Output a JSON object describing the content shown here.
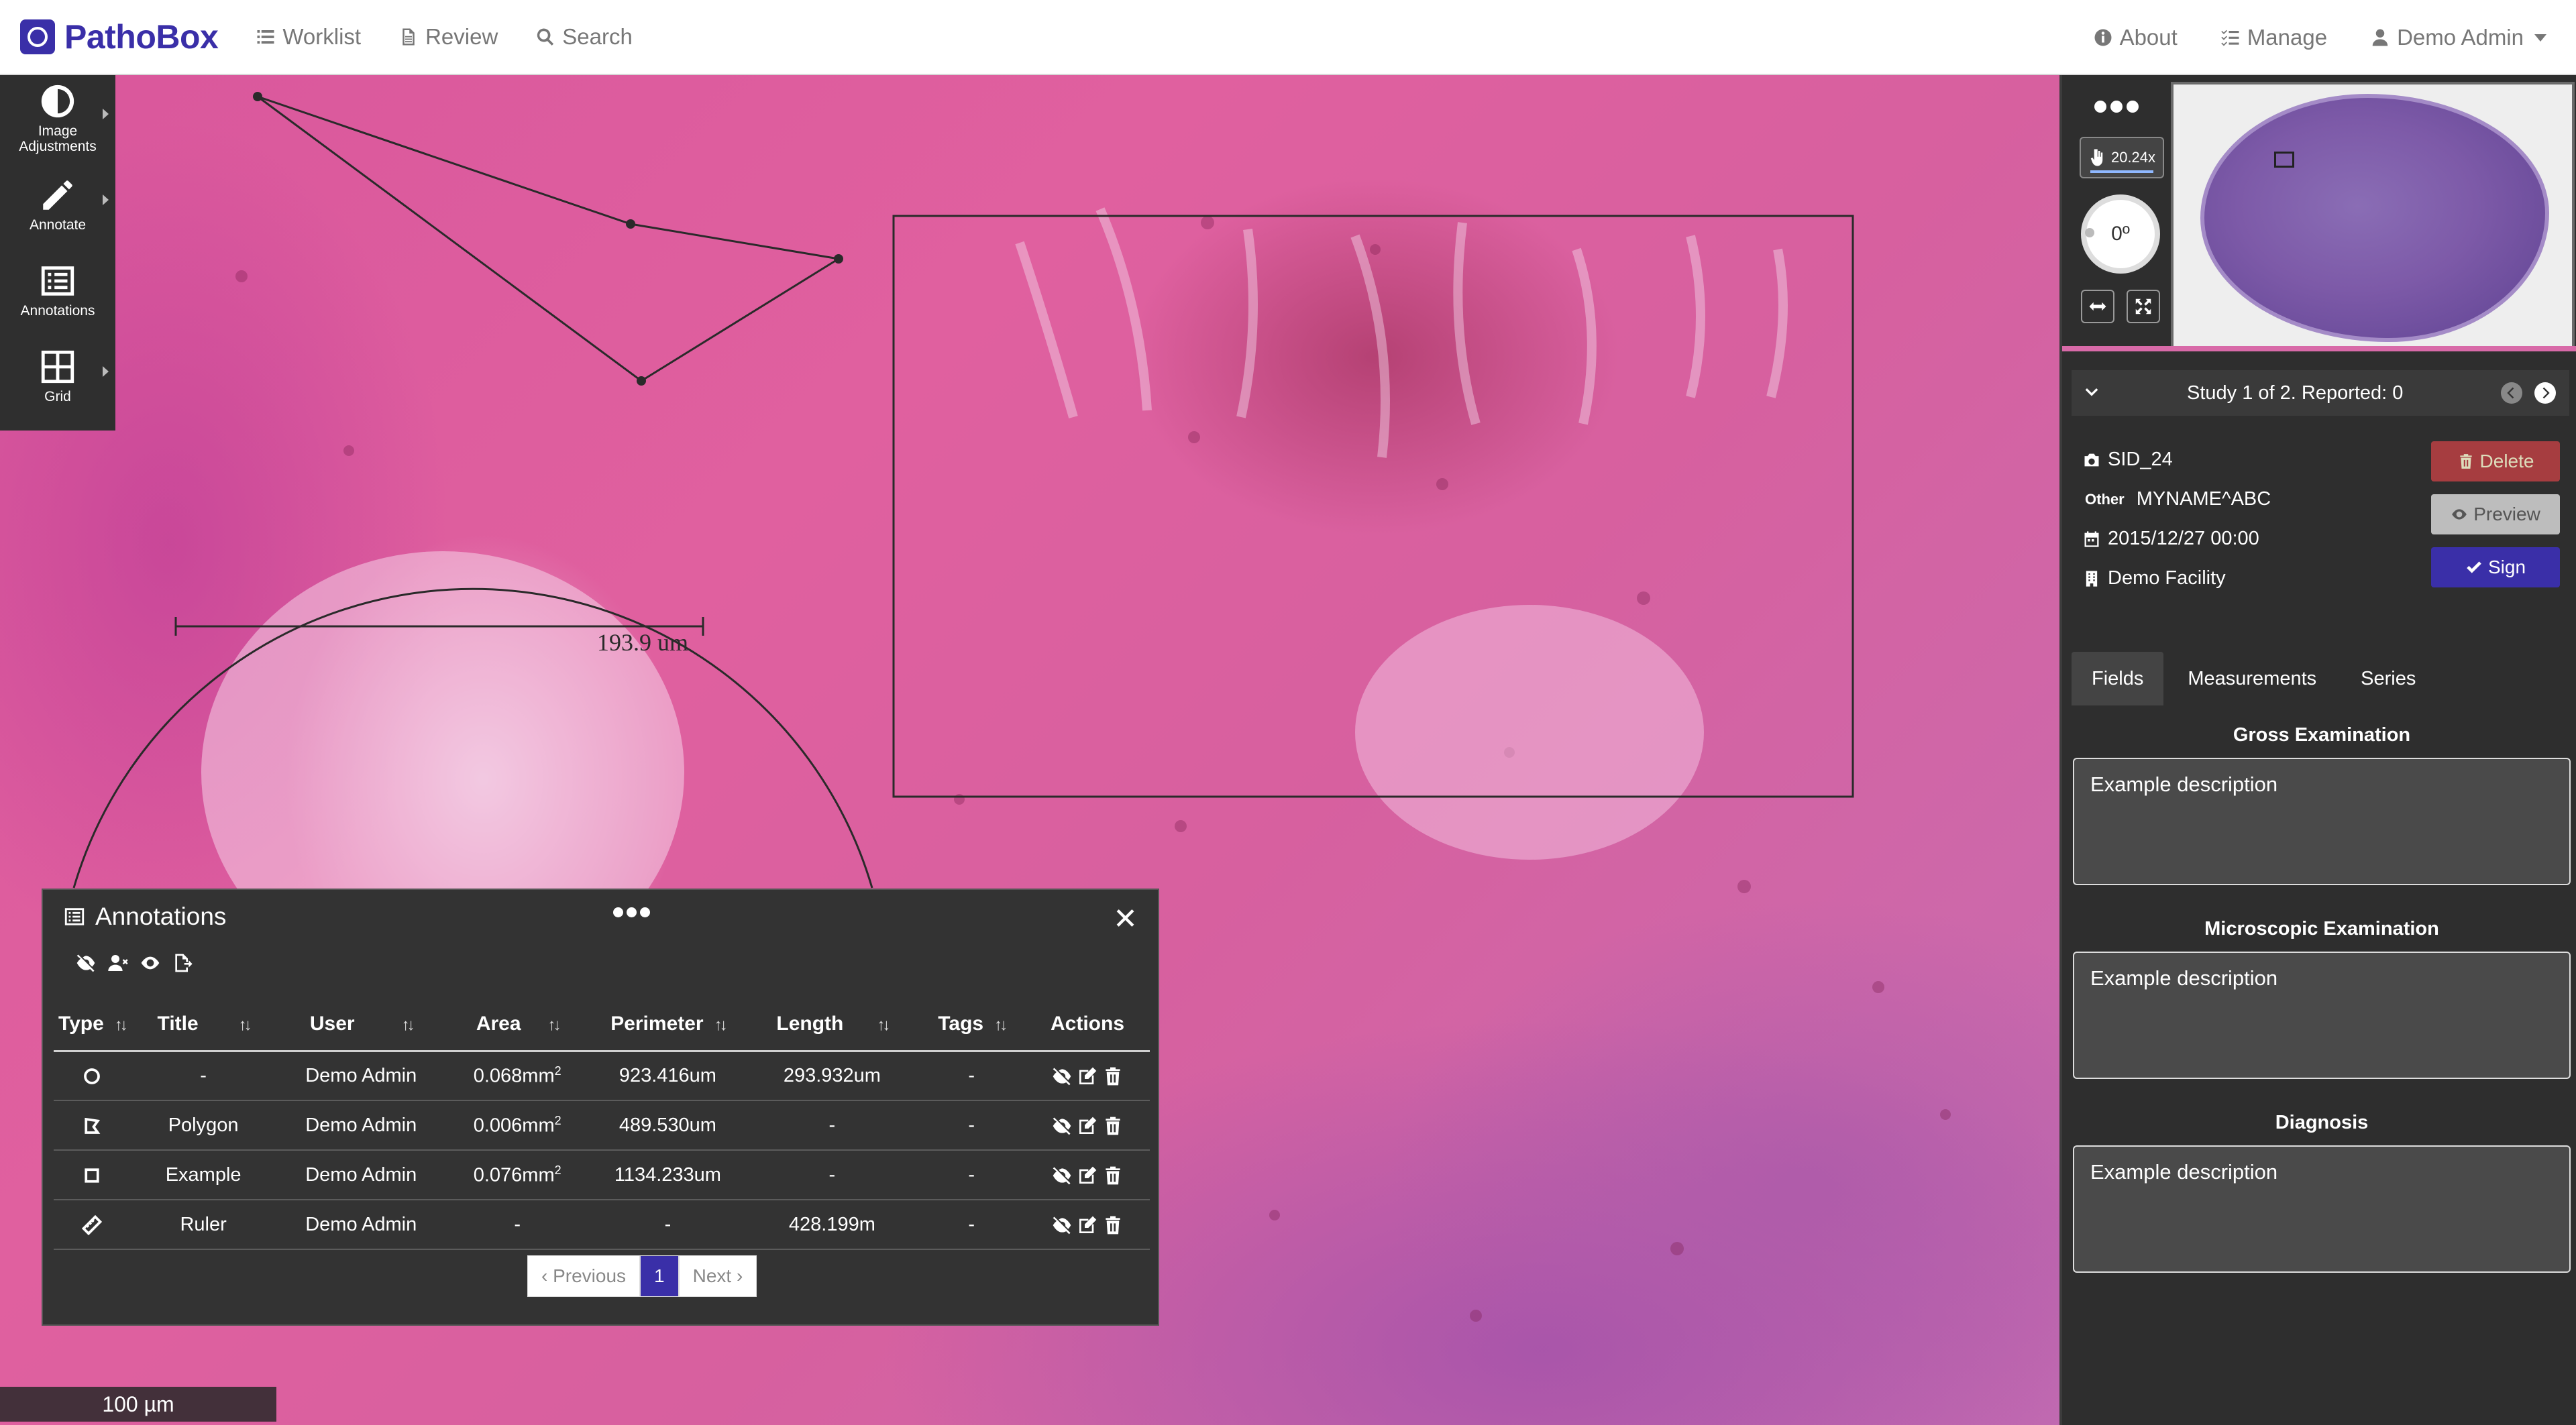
{
  "navbar": {
    "brand": "PathoBox",
    "links": [
      {
        "label": "Worklist",
        "icon": "list-icon"
      },
      {
        "label": "Review",
        "icon": "file-icon"
      },
      {
        "label": "Search",
        "icon": "search-icon"
      }
    ],
    "right": [
      {
        "label": "About",
        "icon": "info-icon"
      },
      {
        "label": "Manage",
        "icon": "tasks-icon"
      },
      {
        "label": "Demo Admin",
        "icon": "user-icon"
      }
    ]
  },
  "tools": [
    {
      "label": "Image Adjustments",
      "icon": "contrast-icon"
    },
    {
      "label": "Annotate",
      "icon": "pencil-icon"
    },
    {
      "label": "Annotations",
      "icon": "list-alt-icon"
    },
    {
      "label": "Grid",
      "icon": "grid-icon"
    }
  ],
  "viewer": {
    "ruler_label": "193.9 um",
    "scalebar": "100 µm"
  },
  "annotations_panel": {
    "title": "Annotations",
    "columns": [
      "Type",
      "Title",
      "User",
      "Area",
      "Perimeter",
      "Length",
      "Tags",
      "Actions"
    ],
    "rows": [
      {
        "type": "circle",
        "title": "-",
        "user": "Demo Admin",
        "area": "0.068mm",
        "perimeter": "923.416um",
        "length": "293.932um",
        "tags": "-"
      },
      {
        "type": "polygon",
        "title": "Polygon",
        "user": "Demo Admin",
        "area": "0.006mm",
        "perimeter": "489.530um",
        "length": "-",
        "tags": "-"
      },
      {
        "type": "rectangle",
        "title": "Example",
        "user": "Demo Admin",
        "area": "0.076mm",
        "perimeter": "1134.233um",
        "length": "-",
        "tags": "-"
      },
      {
        "type": "ruler",
        "title": "Ruler",
        "user": "Demo Admin",
        "area": "-",
        "perimeter": "-",
        "length": "428.199m",
        "tags": "-"
      }
    ],
    "area_unit_exponent": "2",
    "pager": {
      "previous": "Previous",
      "current": "1",
      "next": "Next"
    }
  },
  "navigator": {
    "zoom": "20.24x",
    "rotation": "0º"
  },
  "study": {
    "status": "Study 1 of 2. Reported: 0",
    "sid": "SID_24",
    "other_label": "Other",
    "other_value": "MYNAME^ABC",
    "date": "2015/12/27 00:00",
    "facility": "Demo Facility",
    "buttons": {
      "delete": "Delete",
      "preview": "Preview",
      "sign": "Sign"
    }
  },
  "tabs": [
    "Fields",
    "Measurements",
    "Series"
  ],
  "fields": [
    {
      "heading": "Gross Examination",
      "value": "Example description"
    },
    {
      "heading": "Microscopic Examination",
      "value": "Example description"
    },
    {
      "heading": "Diagnosis",
      "value": "Example description"
    }
  ],
  "colors": {
    "brand": "#3a2fa8",
    "delete": "#a63d40",
    "tissue": "#d9579c"
  }
}
